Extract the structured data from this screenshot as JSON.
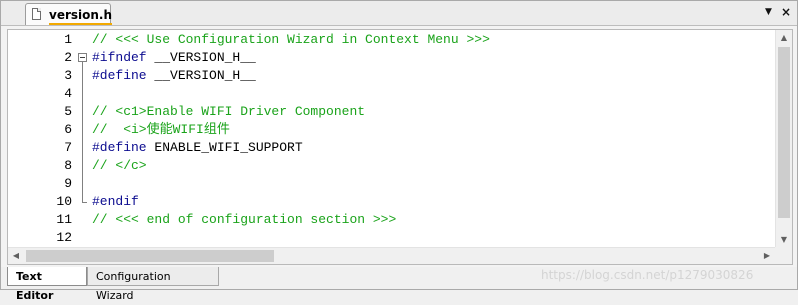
{
  "file_tab": {
    "label": "version.h"
  },
  "window_controls": {
    "dropdown": "▼",
    "close": "×"
  },
  "editor": {
    "lines": [
      {
        "num": "1",
        "segments": [
          {
            "text": "// <<< Use Configuration Wizard in Context Menu >>>",
            "kind": "comment"
          }
        ]
      },
      {
        "num": "2",
        "segments": [
          {
            "text": "#ifndef",
            "kind": "directive"
          },
          {
            "text": " __VERSION_H__",
            "kind": "normal"
          }
        ]
      },
      {
        "num": "3",
        "segments": [
          {
            "text": "#define",
            "kind": "directive"
          },
          {
            "text": " __VERSION_H__",
            "kind": "normal"
          }
        ]
      },
      {
        "num": "4",
        "segments": []
      },
      {
        "num": "5",
        "segments": [
          {
            "text": "// <c1>Enable WIFI Driver Component",
            "kind": "comment"
          }
        ]
      },
      {
        "num": "6",
        "segments": [
          {
            "text": "//  <i>使能WIFI组件",
            "kind": "comment"
          }
        ]
      },
      {
        "num": "7",
        "segments": [
          {
            "text": "#define",
            "kind": "directive"
          },
          {
            "text": " ENABLE_WIFI_SUPPORT",
            "kind": "normal"
          }
        ]
      },
      {
        "num": "8",
        "segments": [
          {
            "text": "// </c>",
            "kind": "comment"
          }
        ]
      },
      {
        "num": "9",
        "segments": []
      },
      {
        "num": "10",
        "segments": [
          {
            "text": "#endif",
            "kind": "directive"
          }
        ]
      },
      {
        "num": "11",
        "segments": [
          {
            "text": "// <<< end of configuration section >>>",
            "kind": "comment"
          }
        ]
      },
      {
        "num": "12",
        "segments": []
      }
    ]
  },
  "bottom_tabs": [
    {
      "label": "Text Editor",
      "active": true
    },
    {
      "label": "Configuration Wizard",
      "active": false
    }
  ],
  "watermark": "https://blog.csdn.net/p1279030826",
  "colors": {
    "comment": "#1aa31a",
    "directive": "#0b0b8f",
    "normal": "#000000"
  }
}
